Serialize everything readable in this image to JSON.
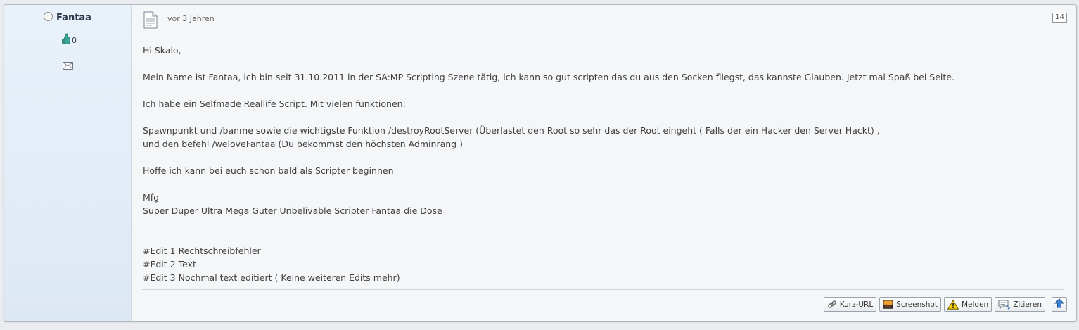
{
  "user": {
    "name": "Fantaa",
    "like_count": "0"
  },
  "post": {
    "date": "vor 3 Jahren",
    "number": "14",
    "message_lines": [
      "Hi Skalo,",
      "",
      "Mein Name ist Fantaa, ich bin seit 31.10.2011 in der SA:MP Scripting Szene tätig, ich kann so gut scripten das du aus den Socken fliegst, das kannste Glauben. Jetzt mal Spaß bei Seite.",
      "",
      "Ich habe ein Selfmade Reallife Script. Mit vielen funktionen:",
      "",
      "Spawnpunkt und /banme sowie die wichtigste Funktion /destroyRootServer (Überlastet den Root so sehr das der Root eingeht ( Falls der ein Hacker den Server Hackt) ,",
      "und den befehl /weloveFantaa (Du bekommst den höchsten Adminrang )",
      "",
      "Hoffe ich kann bei euch schon bald als Scripter beginnen",
      "",
      "Mfg",
      "Super Duper Ultra Mega Guter Unbelivable Scripter Fantaa die Dose",
      "",
      "",
      "#Edit 1 Rechtschreibfehler",
      "#Edit 2 Text",
      "#Edit 3 Nochmal text editiert ( Keine weiteren Edits mehr)"
    ]
  },
  "actions": {
    "short_url": "Kurz-URL",
    "screenshot": "Screenshot",
    "report": "Melden",
    "quote": "Zitieren"
  },
  "icons": {
    "status": "offline-status-icon",
    "like": "thumbs-up-icon",
    "mail": "envelope-icon",
    "document": "document-icon",
    "link": "link-icon",
    "screenshot": "image-icon",
    "report": "warning-icon",
    "quote": "quote-icon",
    "top": "arrow-up-icon"
  }
}
